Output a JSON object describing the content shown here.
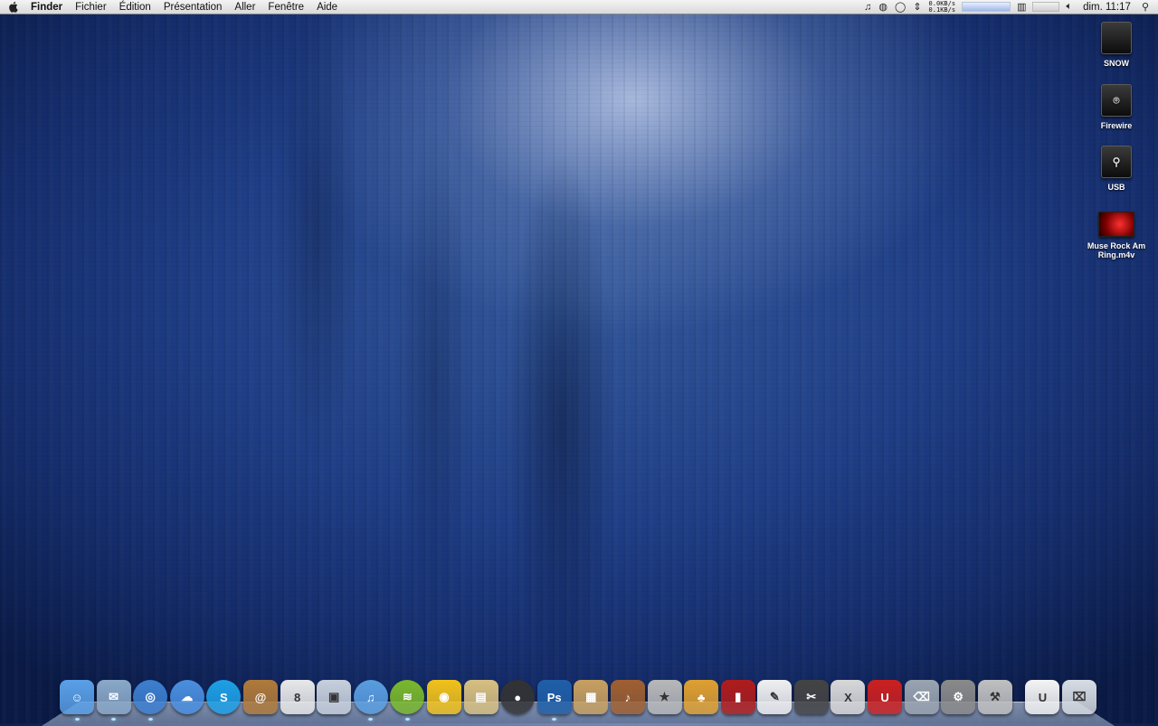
{
  "menubar": {
    "apple_icon": "apple-icon",
    "app_name": "Finder",
    "menus": [
      "Fichier",
      "Édition",
      "Présentation",
      "Aller",
      "Fenêtre",
      "Aide"
    ],
    "status": {
      "net_up": "0.0KB/s",
      "net_down": "0.1KB/s",
      "clock": "dim. 11:17"
    }
  },
  "desktop": {
    "icons": [
      {
        "label": "SNOW",
        "type": "drive",
        "glyph": ""
      },
      {
        "label": "Firewire",
        "type": "drive",
        "glyph": "⌾"
      },
      {
        "label": "USB",
        "type": "drive",
        "glyph": "⚲"
      },
      {
        "label": "Muse Rock Am Ring.m4v",
        "type": "movie"
      }
    ]
  },
  "dock": {
    "items": [
      {
        "name": "finder",
        "glyph": "☺",
        "color": "#5aa0e8"
      },
      {
        "name": "mail",
        "glyph": "✉",
        "color": "#8aa8c8"
      },
      {
        "name": "safari",
        "glyph": "◎",
        "color": "#3d7fd0"
      },
      {
        "name": "ichat",
        "glyph": "☁",
        "color": "#4a8fe0"
      },
      {
        "name": "skype",
        "glyph": "S",
        "color": "#1ea0e6"
      },
      {
        "name": "address-book",
        "glyph": "@",
        "color": "#b07a3a"
      },
      {
        "name": "ical",
        "glyph": "8",
        "color": "#e8e8e8"
      },
      {
        "name": "preview",
        "glyph": "▣",
        "color": "#c7d0dc"
      },
      {
        "name": "itunes",
        "glyph": "♫",
        "color": "#5a9ee0"
      },
      {
        "name": "spotify",
        "glyph": "≋",
        "color": "#7ab82c"
      },
      {
        "name": "cyberduck",
        "glyph": "◉",
        "color": "#f2c21a"
      },
      {
        "name": "iphoto",
        "glyph": "▤",
        "color": "#d8c080"
      },
      {
        "name": "photo-booth",
        "glyph": "●",
        "color": "#333333"
      },
      {
        "name": "photoshop",
        "glyph": "Ps",
        "color": "#1f5fa8"
      },
      {
        "name": "image-viewer",
        "glyph": "▦",
        "color": "#c8a060"
      },
      {
        "name": "garageband",
        "glyph": "♪",
        "color": "#a06030"
      },
      {
        "name": "imovie",
        "glyph": "★",
        "color": "#b8b8b8"
      },
      {
        "name": "adium",
        "glyph": "♣",
        "color": "#e0a030"
      },
      {
        "name": "front-row",
        "glyph": "▮",
        "color": "#b01c1c"
      },
      {
        "name": "textedit",
        "glyph": "✎",
        "color": "#f0f0f0"
      },
      {
        "name": "final-cut",
        "glyph": "✂",
        "color": "#444444"
      },
      {
        "name": "x11",
        "glyph": "X",
        "color": "#d8d8d8"
      },
      {
        "name": "magnet",
        "glyph": "U",
        "color": "#cc2020"
      },
      {
        "name": "trash-app",
        "glyph": "⌫",
        "color": "#9aa4b0"
      },
      {
        "name": "system-preferences",
        "glyph": "⚙",
        "color": "#8a8a8a"
      },
      {
        "name": "utility",
        "glyph": "⚒",
        "color": "#c0c0c0"
      },
      {
        "name": "sep",
        "glyph": ""
      },
      {
        "name": "nzb-document",
        "glyph": "U",
        "color": "#f4f4f4"
      },
      {
        "name": "trash",
        "glyph": "⌧",
        "color": "#d8dde4"
      }
    ],
    "running": [
      "finder",
      "mail",
      "safari",
      "itunes",
      "spotify",
      "photoshop"
    ]
  }
}
